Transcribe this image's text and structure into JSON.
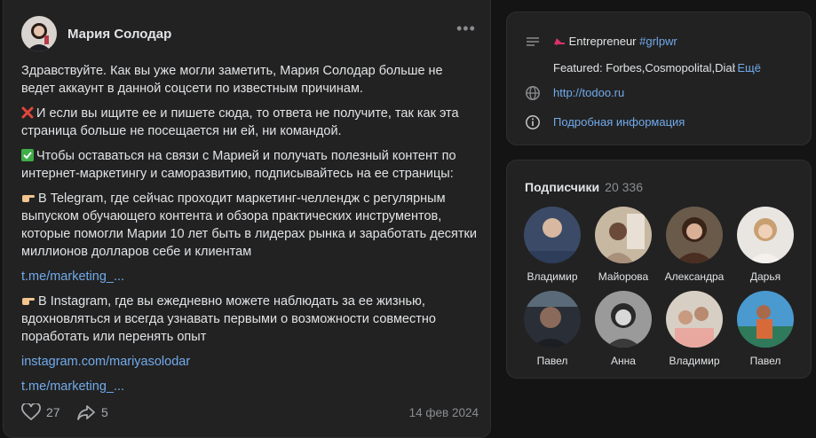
{
  "post": {
    "author": "Мария Солодар",
    "more_icon": "•••",
    "paragraphs": [
      "Здравствуйте. Как вы уже могли заметить, Мария Солодар больше не ведет аккаунт в данной соцсети по известным причинам.",
      "И если вы ищите ее и пишете сюда, то ответа не получите, так как эта страница больше не посещается ни ей, ни командой.",
      "Чтобы оставаться на связи с Марией и получать полезный контент по интернет-маркетингу и саморазвитию, подписывайтесь на ее страницы:",
      "В Telegram, где сейчас проходит маркетинг-челлендж с регулярным выпуском обучающего контента и обзора практических инструментов, которые помогли Марии 10 лет быть в лидерах рынка и заработать десятки миллионов долларов себе и клиентам",
      "t.me/marketing_...",
      "В Instagram, где вы ежедневно можете наблюдать за ее жизнью, вдохновляться и всегда узнавать первыми о возможности совместно поработать или перенять опыт",
      "instagram.com/mariyasolodar",
      "t.me/marketing_..."
    ],
    "likes": "27",
    "shares": "5",
    "date": "14 фев 2024"
  },
  "info": {
    "status_prefix": "Entrepreneur",
    "status_tag": "#grlpwr",
    "featured": "Featured: Forbes,Cosmopolital,Diab",
    "featured_more": "Ещё",
    "site": "http://todoo.ru",
    "details": "Подробная информация"
  },
  "subscribers": {
    "title": "Подписчики",
    "count": "20 336",
    "people": [
      {
        "name": "Владимир"
      },
      {
        "name": "Майорова"
      },
      {
        "name": "Александра"
      },
      {
        "name": "Дарья"
      },
      {
        "name": "Павел"
      },
      {
        "name": "Анна"
      },
      {
        "name": "Владимир"
      },
      {
        "name": "Павел"
      }
    ]
  },
  "colors": {
    "background": "#141414",
    "card": "#222222",
    "link": "#71aaeb",
    "text": "#e1e3e6",
    "muted": "#8a8c90"
  }
}
